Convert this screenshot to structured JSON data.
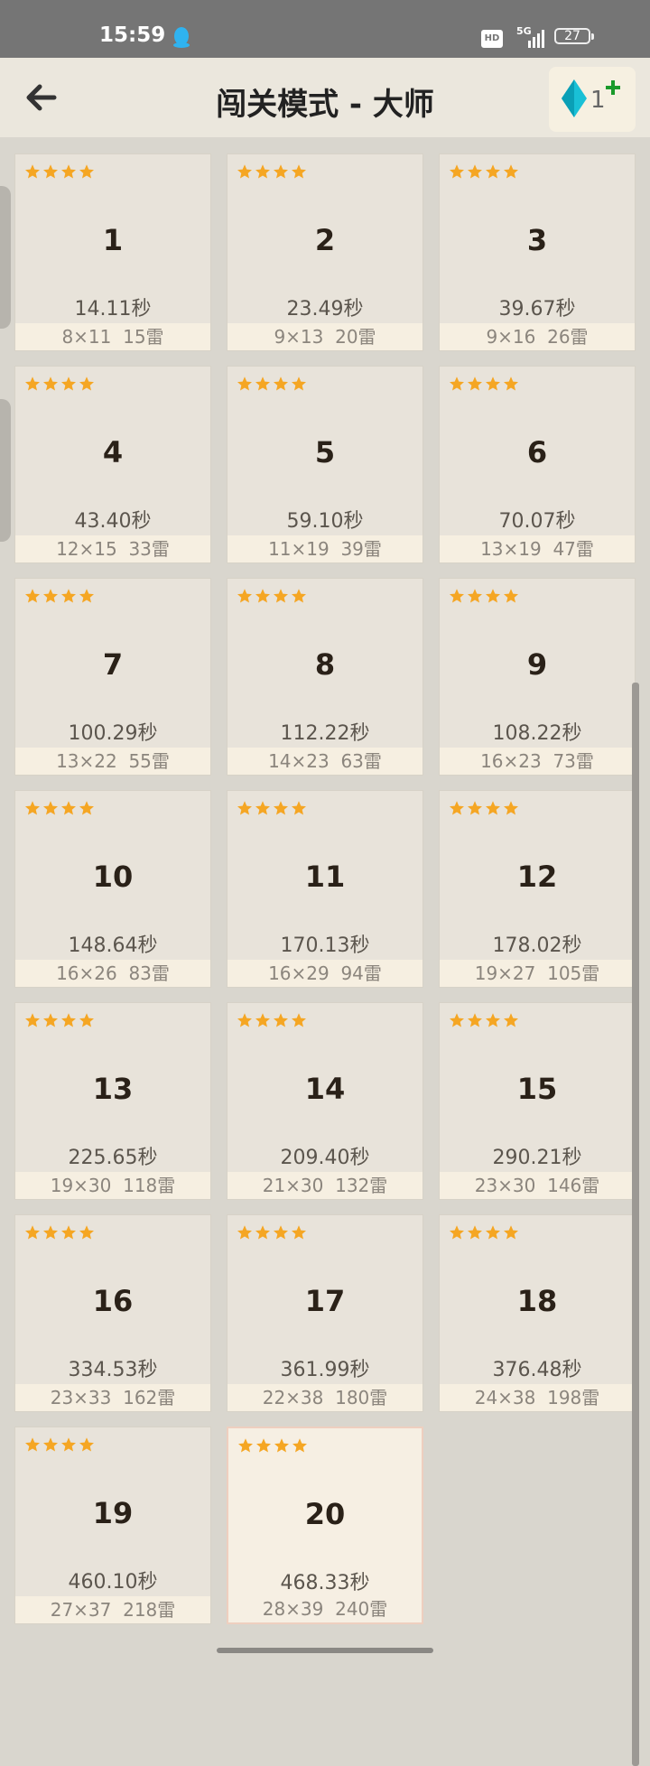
{
  "status_bar": {
    "time": "15:59",
    "network": "5G",
    "hd": "HD",
    "battery": "27"
  },
  "header": {
    "title": "闯关模式 - 大师",
    "gem_count": "1",
    "back_icon": "arrow-left-icon",
    "gem_icon": "diamond-icon",
    "add_icon": "plus-icon"
  },
  "colors": {
    "star": "#f5a623",
    "gem": "#1fb5c9",
    "add": "#1a9a2a"
  },
  "levels": [
    {
      "number": "1",
      "stars": 4,
      "time": "14.11秒",
      "size": "8×11",
      "mines": "15雷"
    },
    {
      "number": "2",
      "stars": 4,
      "time": "23.49秒",
      "size": "9×13",
      "mines": "20雷"
    },
    {
      "number": "3",
      "stars": 4,
      "time": "39.67秒",
      "size": "9×16",
      "mines": "26雷"
    },
    {
      "number": "4",
      "stars": 4,
      "time": "43.40秒",
      "size": "12×15",
      "mines": "33雷"
    },
    {
      "number": "5",
      "stars": 4,
      "time": "59.10秒",
      "size": "11×19",
      "mines": "39雷"
    },
    {
      "number": "6",
      "stars": 4,
      "time": "70.07秒",
      "size": "13×19",
      "mines": "47雷"
    },
    {
      "number": "7",
      "stars": 4,
      "time": "100.29秒",
      "size": "13×22",
      "mines": "55雷"
    },
    {
      "number": "8",
      "stars": 4,
      "time": "112.22秒",
      "size": "14×23",
      "mines": "63雷"
    },
    {
      "number": "9",
      "stars": 4,
      "time": "108.22秒",
      "size": "16×23",
      "mines": "73雷"
    },
    {
      "number": "10",
      "stars": 4,
      "time": "148.64秒",
      "size": "16×26",
      "mines": "83雷"
    },
    {
      "number": "11",
      "stars": 4,
      "time": "170.13秒",
      "size": "16×29",
      "mines": "94雷"
    },
    {
      "number": "12",
      "stars": 4,
      "time": "178.02秒",
      "size": "19×27",
      "mines": "105雷"
    },
    {
      "number": "13",
      "stars": 4,
      "time": "225.65秒",
      "size": "19×30",
      "mines": "118雷"
    },
    {
      "number": "14",
      "stars": 4,
      "time": "209.40秒",
      "size": "21×30",
      "mines": "132雷"
    },
    {
      "number": "15",
      "stars": 4,
      "time": "290.21秒",
      "size": "23×30",
      "mines": "146雷"
    },
    {
      "number": "16",
      "stars": 4,
      "time": "334.53秒",
      "size": "23×33",
      "mines": "162雷"
    },
    {
      "number": "17",
      "stars": 4,
      "time": "361.99秒",
      "size": "22×38",
      "mines": "180雷"
    },
    {
      "number": "18",
      "stars": 4,
      "time": "376.48秒",
      "size": "24×38",
      "mines": "198雷"
    },
    {
      "number": "19",
      "stars": 4,
      "time": "460.10秒",
      "size": "27×37",
      "mines": "218雷"
    },
    {
      "number": "20",
      "stars": 4,
      "time": "468.33秒",
      "size": "28×39",
      "mines": "240雷",
      "current": true
    }
  ]
}
